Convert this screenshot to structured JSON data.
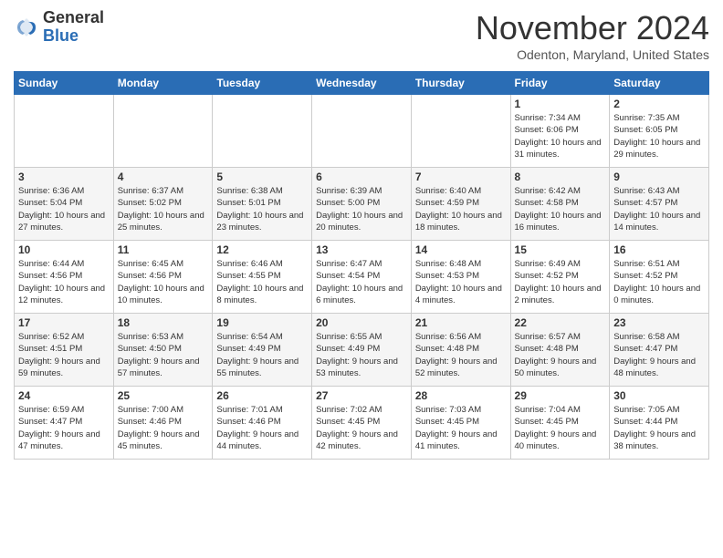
{
  "logo": {
    "line1": "General",
    "line2": "Blue"
  },
  "title": "November 2024",
  "subtitle": "Odenton, Maryland, United States",
  "days_of_week": [
    "Sunday",
    "Monday",
    "Tuesday",
    "Wednesday",
    "Thursday",
    "Friday",
    "Saturday"
  ],
  "weeks": [
    [
      {
        "day": "",
        "info": ""
      },
      {
        "day": "",
        "info": ""
      },
      {
        "day": "",
        "info": ""
      },
      {
        "day": "",
        "info": ""
      },
      {
        "day": "",
        "info": ""
      },
      {
        "day": "1",
        "info": "Sunrise: 7:34 AM\nSunset: 6:06 PM\nDaylight: 10 hours and 31 minutes."
      },
      {
        "day": "2",
        "info": "Sunrise: 7:35 AM\nSunset: 6:05 PM\nDaylight: 10 hours and 29 minutes."
      }
    ],
    [
      {
        "day": "3",
        "info": "Sunrise: 6:36 AM\nSunset: 5:04 PM\nDaylight: 10 hours and 27 minutes."
      },
      {
        "day": "4",
        "info": "Sunrise: 6:37 AM\nSunset: 5:02 PM\nDaylight: 10 hours and 25 minutes."
      },
      {
        "day": "5",
        "info": "Sunrise: 6:38 AM\nSunset: 5:01 PM\nDaylight: 10 hours and 23 minutes."
      },
      {
        "day": "6",
        "info": "Sunrise: 6:39 AM\nSunset: 5:00 PM\nDaylight: 10 hours and 20 minutes."
      },
      {
        "day": "7",
        "info": "Sunrise: 6:40 AM\nSunset: 4:59 PM\nDaylight: 10 hours and 18 minutes."
      },
      {
        "day": "8",
        "info": "Sunrise: 6:42 AM\nSunset: 4:58 PM\nDaylight: 10 hours and 16 minutes."
      },
      {
        "day": "9",
        "info": "Sunrise: 6:43 AM\nSunset: 4:57 PM\nDaylight: 10 hours and 14 minutes."
      }
    ],
    [
      {
        "day": "10",
        "info": "Sunrise: 6:44 AM\nSunset: 4:56 PM\nDaylight: 10 hours and 12 minutes."
      },
      {
        "day": "11",
        "info": "Sunrise: 6:45 AM\nSunset: 4:56 PM\nDaylight: 10 hours and 10 minutes."
      },
      {
        "day": "12",
        "info": "Sunrise: 6:46 AM\nSunset: 4:55 PM\nDaylight: 10 hours and 8 minutes."
      },
      {
        "day": "13",
        "info": "Sunrise: 6:47 AM\nSunset: 4:54 PM\nDaylight: 10 hours and 6 minutes."
      },
      {
        "day": "14",
        "info": "Sunrise: 6:48 AM\nSunset: 4:53 PM\nDaylight: 10 hours and 4 minutes."
      },
      {
        "day": "15",
        "info": "Sunrise: 6:49 AM\nSunset: 4:52 PM\nDaylight: 10 hours and 2 minutes."
      },
      {
        "day": "16",
        "info": "Sunrise: 6:51 AM\nSunset: 4:52 PM\nDaylight: 10 hours and 0 minutes."
      }
    ],
    [
      {
        "day": "17",
        "info": "Sunrise: 6:52 AM\nSunset: 4:51 PM\nDaylight: 9 hours and 59 minutes."
      },
      {
        "day": "18",
        "info": "Sunrise: 6:53 AM\nSunset: 4:50 PM\nDaylight: 9 hours and 57 minutes."
      },
      {
        "day": "19",
        "info": "Sunrise: 6:54 AM\nSunset: 4:49 PM\nDaylight: 9 hours and 55 minutes."
      },
      {
        "day": "20",
        "info": "Sunrise: 6:55 AM\nSunset: 4:49 PM\nDaylight: 9 hours and 53 minutes."
      },
      {
        "day": "21",
        "info": "Sunrise: 6:56 AM\nSunset: 4:48 PM\nDaylight: 9 hours and 52 minutes."
      },
      {
        "day": "22",
        "info": "Sunrise: 6:57 AM\nSunset: 4:48 PM\nDaylight: 9 hours and 50 minutes."
      },
      {
        "day": "23",
        "info": "Sunrise: 6:58 AM\nSunset: 4:47 PM\nDaylight: 9 hours and 48 minutes."
      }
    ],
    [
      {
        "day": "24",
        "info": "Sunrise: 6:59 AM\nSunset: 4:47 PM\nDaylight: 9 hours and 47 minutes."
      },
      {
        "day": "25",
        "info": "Sunrise: 7:00 AM\nSunset: 4:46 PM\nDaylight: 9 hours and 45 minutes."
      },
      {
        "day": "26",
        "info": "Sunrise: 7:01 AM\nSunset: 4:46 PM\nDaylight: 9 hours and 44 minutes."
      },
      {
        "day": "27",
        "info": "Sunrise: 7:02 AM\nSunset: 4:45 PM\nDaylight: 9 hours and 42 minutes."
      },
      {
        "day": "28",
        "info": "Sunrise: 7:03 AM\nSunset: 4:45 PM\nDaylight: 9 hours and 41 minutes."
      },
      {
        "day": "29",
        "info": "Sunrise: 7:04 AM\nSunset: 4:45 PM\nDaylight: 9 hours and 40 minutes."
      },
      {
        "day": "30",
        "info": "Sunrise: 7:05 AM\nSunset: 4:44 PM\nDaylight: 9 hours and 38 minutes."
      }
    ]
  ]
}
